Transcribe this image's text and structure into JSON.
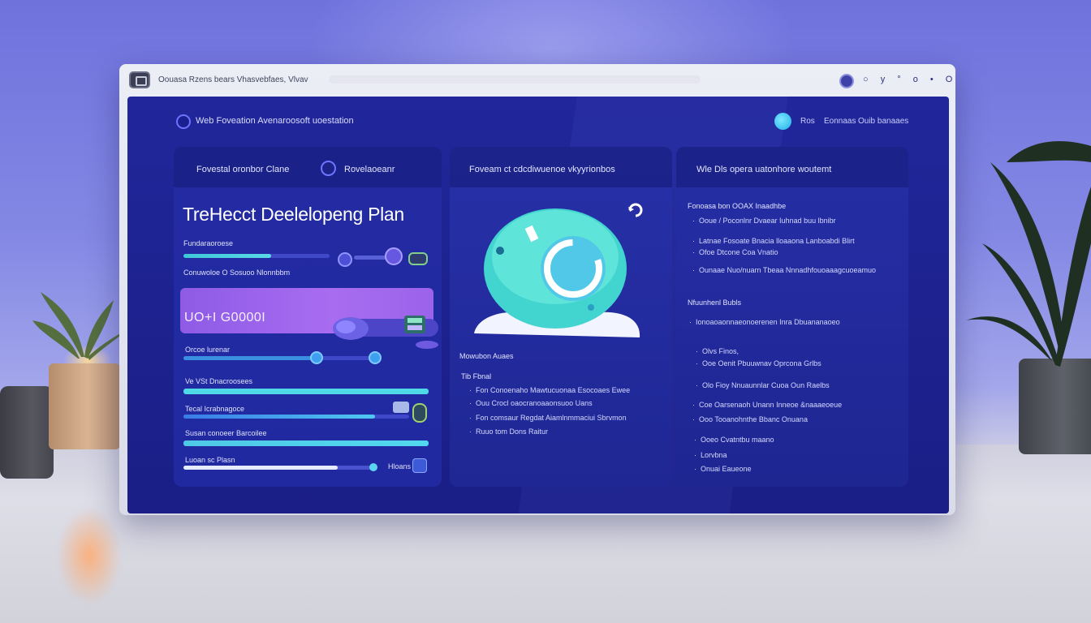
{
  "window": {
    "title": "Oouasa Rzens bears Vhasvebfaes, Vlvav",
    "toolbar_icons": "○ y ° o • O"
  },
  "app": {
    "brand": "Web Foveation Avenaroosoft uoestation",
    "nav": [
      "Ros",
      "Eonnaas",
      "Ouib banaaes"
    ]
  },
  "left_panel": {
    "header_label": "Fovestal oronbor Clane",
    "header_label_2": "Rovelaoeanr",
    "title": "TreHecct Deelelopeng Plan",
    "rows": [
      {
        "label": "Fundaraoroese",
        "progress": 0.6
      },
      {
        "label": "Conuwoloe O Sosuoo Nlonnbbm"
      }
    ],
    "highlight_value": "UO+I G0000I",
    "sliders": [
      {
        "label": "Orcoe lurenar",
        "progress": 0.68
      },
      {
        "label": "Ve VSt Dnacroosees",
        "progress": 1.0
      },
      {
        "label": "Tecal Icrabnagoce",
        "progress": 0.85
      },
      {
        "label": "Susan conoeer Barcoilee",
        "progress": 1.0
      },
      {
        "label": "Luoan sc Plasn",
        "progress": 0.8,
        "end_label": "Hloans"
      }
    ]
  },
  "mid_panel": {
    "header": "Foveam ct cdcdiwuenoe vkyyrionbos",
    "section1": "Mowubon Auaes",
    "section2": "Tib Fbnal",
    "bullets": [
      "Fon Conoenaho Mawtucuonaa Esocoaes Ewee",
      "Ouu Crocl oaocranoaaonsuoo Uans",
      "Fon comsaur Regdat Aiamlnmmaciui Sbrvmon",
      "Ruuo tom Dons Raitur"
    ]
  },
  "right_panel": {
    "header": "Wle Dls opera uatonhore woutemt",
    "section1": "Fonoasa bon OOAX Inaadhbe",
    "bullets1": [
      "Ooue / Poconlnr Dvaear Iuhnad buu lbnibr",
      "Latnae Fosoate Bnacia lloaaona Lanboabdi Blirt",
      "Ofoe Dtcone Coa Vnatio",
      "Ounaae Nuo/nuarn Tbeaa Nnnadhfouoaaagcuoeamuo"
    ],
    "section2": "Nfuunhenl Bubls",
    "bullets2": [
      "Ionoaoaonnaeonoerenen Inra Dbuananaoeo",
      "Olvs Finos,",
      "Ooe Oenit Pbuuwnav Oprcona Grlbs",
      "Olo Fioy Nnuaunnlar Cuoa Oun Raelbs",
      "Coe Oarsenaoh Unann Inneoe &naaaeoeue",
      "Ooo Tooanohnthe Bbanc Onuana",
      "Ooeo Cvatntbu maano",
      "Lorvbna",
      "Onuai Eaueone"
    ]
  },
  "colors": {
    "accent_teal": "#4fd8e6",
    "accent_purple": "#9b63ea",
    "panel_bg": "#232a9c"
  }
}
